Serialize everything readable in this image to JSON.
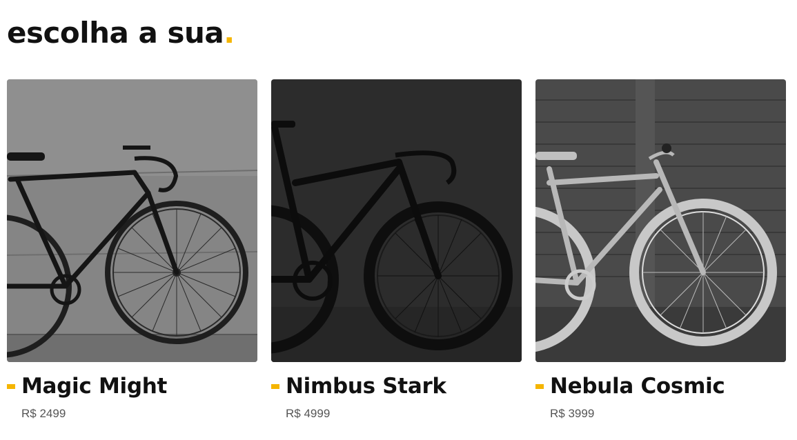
{
  "section": {
    "title": "escolha a sua",
    "title_dot": ".",
    "accent_color": "#f5b500"
  },
  "products": [
    {
      "name": "Magic Might",
      "price": "R$ 2499",
      "image": "bicycle-photo-gray-wall"
    },
    {
      "name": "Nimbus Stark",
      "price": "R$ 4999",
      "image": "bicycle-photo-dark-studio"
    },
    {
      "name": "Nebula Cosmic",
      "price": "R$ 3999",
      "image": "bicycle-photo-light-wood-wall"
    }
  ]
}
